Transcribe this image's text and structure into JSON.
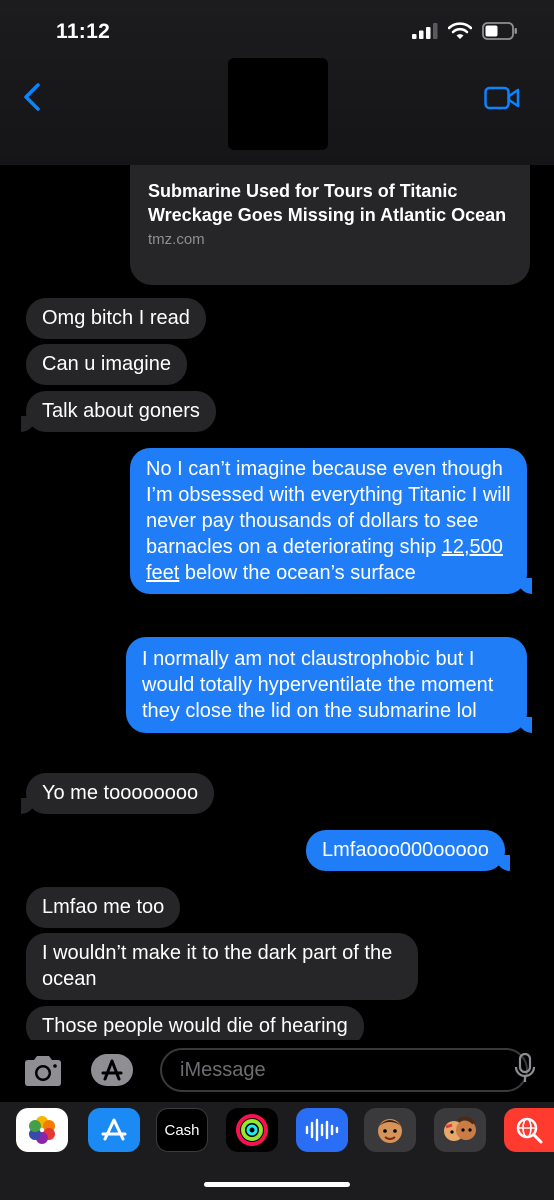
{
  "status": {
    "time": "11:12"
  },
  "link_preview": {
    "title": "Submarine Used for Tours of Titanic Wreckage Goes Missing in Atlantic Ocean",
    "domain": "tmz.com"
  },
  "messages": [
    {
      "dir": "in",
      "text": "Omg bitch I read"
    },
    {
      "dir": "in",
      "text": "Can u imagine"
    },
    {
      "dir": "in",
      "text": "Talk about goners"
    },
    {
      "dir": "out",
      "text_before": "No I can’t imagine because even though I’m obsessed with everything Titanic I will never pay thousands of dollars to see barnacles on a deteriorating ship ",
      "link": "12,500 feet",
      "text_after": " below the ocean’s surface"
    },
    {
      "dir": "out",
      "text": "I normally am not claustrophobic but I would totally hyperventilate the moment they close the lid on the submarine lol"
    },
    {
      "dir": "in",
      "text": "Yo me toooooooo"
    },
    {
      "dir": "out",
      "text": "Lmfaooo000ooooo"
    },
    {
      "dir": "in",
      "text": "Lmfao me too"
    },
    {
      "dir": "in",
      "text": "I wouldn’t make it to the dark part of the ocean"
    },
    {
      "dir": "in",
      "text": "Those people would die of hearing"
    }
  ],
  "compose": {
    "placeholder": "iMessage"
  },
  "tray": {
    "cash_label": "Cash"
  },
  "colors": {
    "outgoing": "#1f7ef7",
    "incoming": "#262628",
    "accent": "#0a84ff"
  }
}
